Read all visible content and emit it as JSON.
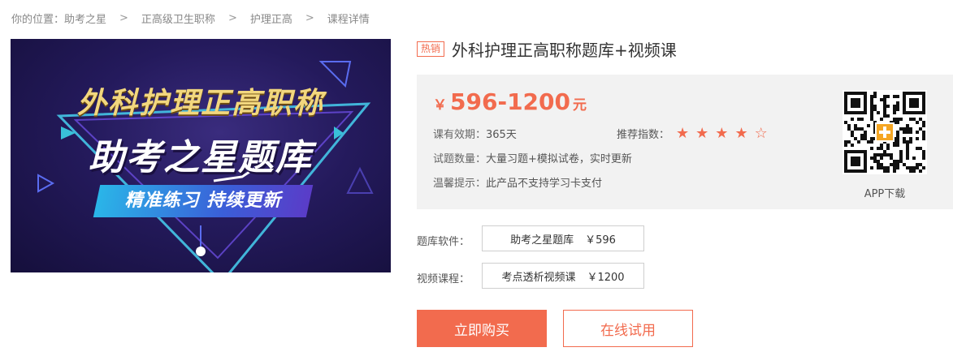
{
  "breadcrumb": {
    "items": [
      "你的位置：助考之星",
      "正高级卫生职称",
      "护理正高",
      "课程详情"
    ],
    "separator": ">"
  },
  "banner": {
    "line1": "外科护理正高职称",
    "line2": "助考之星题库",
    "line3": "精准练习 持续更新"
  },
  "product": {
    "badge": "热销",
    "title": "外科护理正高职称题库+视频课",
    "price": {
      "currency": "￥",
      "range": "596-1200",
      "unit": "元"
    },
    "validity_label": "课有效期：",
    "validity_value": "365天",
    "rating_label": "推荐指数：",
    "rating": 4,
    "rating_max": 5,
    "quantity_label": "试题数量：",
    "quantity_value": "大量习题+模拟试卷，实时更新",
    "tip_label": "温馨提示：",
    "tip_value": "此产品不支持学习卡支付",
    "app_download": "APP下载"
  },
  "options": {
    "software_label": "题库软件：",
    "software_name": "助考之星题库",
    "software_price": "￥596",
    "video_label": "视频课程：",
    "video_name": "考点透析视频课",
    "video_price": "￥1200"
  },
  "actions": {
    "buy": "立即购买",
    "try": "在线试用"
  },
  "colors": {
    "accent": "#f26b4e",
    "info_bg": "#f2f2f2"
  }
}
